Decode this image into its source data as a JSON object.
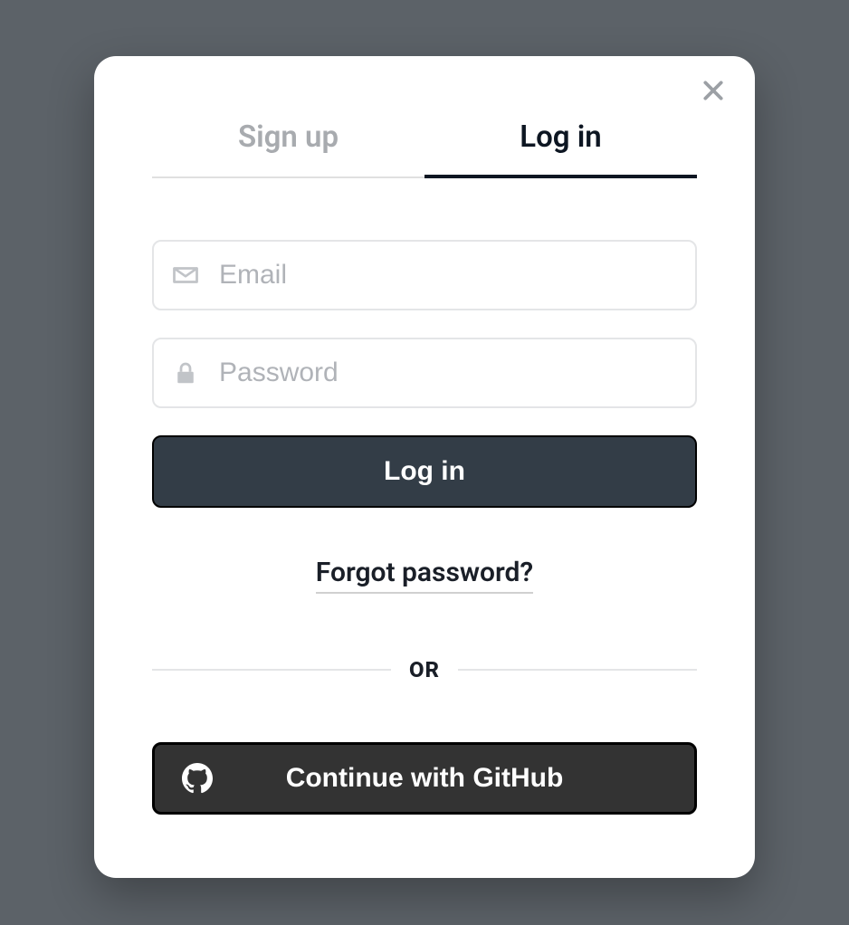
{
  "tabs": {
    "signup_label": "Sign up",
    "login_label": "Log in"
  },
  "form": {
    "email_placeholder": "Email",
    "password_placeholder": "Password",
    "login_button_label": "Log in",
    "forgot_password_label": "Forgot password?"
  },
  "divider": {
    "text": "OR"
  },
  "oauth": {
    "github_label": "Continue with GitHub"
  }
}
